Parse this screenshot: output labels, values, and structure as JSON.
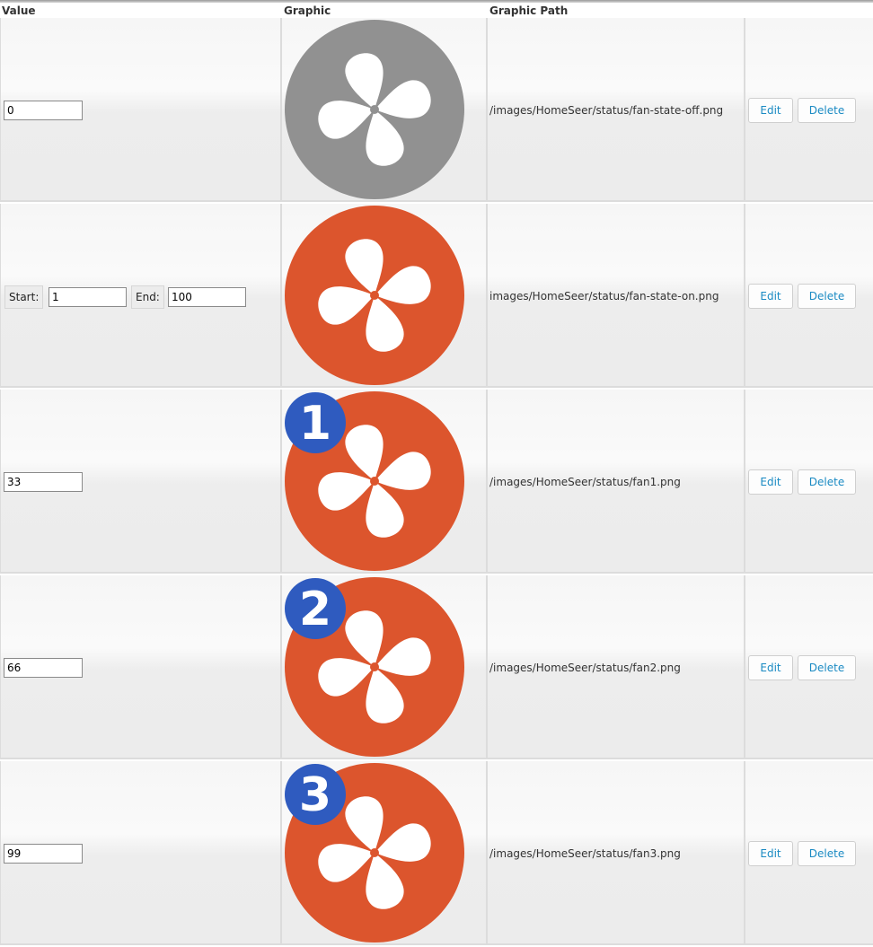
{
  "columns": {
    "value": "Value",
    "graphic": "Graphic",
    "path": "Graphic Path"
  },
  "colors": {
    "off": "#919191",
    "on": "#dc552d",
    "badge": "#2f5bbf",
    "link": "#1a8ac3"
  },
  "rows": [
    {
      "type": "single",
      "value": "0",
      "graphic": {
        "icon": "fan-state-off-icon",
        "state": "off"
      },
      "path": "/images/HomeSeer/status/fan-state-off.png",
      "edit_label": "Edit",
      "delete_label": "Delete"
    },
    {
      "type": "range",
      "start_label": "Start:",
      "start_value": "1",
      "end_label": "End:",
      "end_value": "100",
      "graphic": {
        "icon": "fan-state-on-icon",
        "state": "on"
      },
      "path": "images/HomeSeer/status/fan-state-on.png",
      "edit_label": "Edit",
      "delete_label": "Delete"
    },
    {
      "type": "single",
      "value": "33",
      "graphic": {
        "icon": "fan-speed-1-icon",
        "state": "on",
        "badge": "1"
      },
      "path": "/images/HomeSeer/status/fan1.png",
      "edit_label": "Edit",
      "delete_label": "Delete"
    },
    {
      "type": "single",
      "value": "66",
      "graphic": {
        "icon": "fan-speed-2-icon",
        "state": "on",
        "badge": "2"
      },
      "path": "/images/HomeSeer/status/fan2.png",
      "edit_label": "Edit",
      "delete_label": "Delete"
    },
    {
      "type": "single",
      "value": "99",
      "graphic": {
        "icon": "fan-speed-3-icon",
        "state": "on",
        "badge": "3"
      },
      "path": "/images/HomeSeer/status/fan3.png",
      "edit_label": "Edit",
      "delete_label": "Delete"
    }
  ]
}
